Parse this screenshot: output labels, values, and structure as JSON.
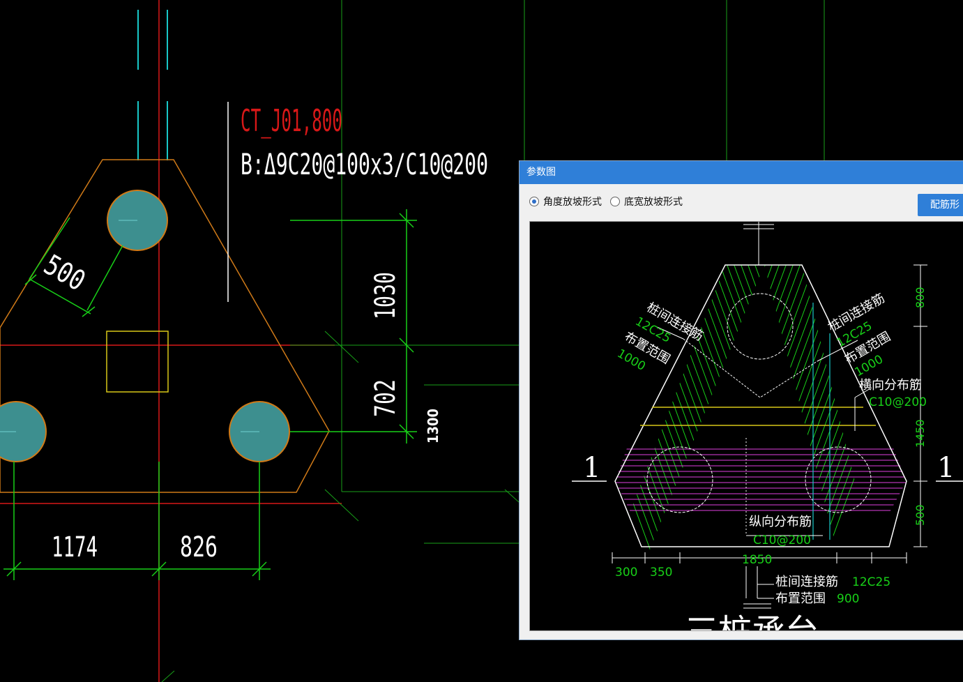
{
  "cad": {
    "label_ct": "CT_J01,800",
    "label_b": "B:Δ9C20@100x3/C10@200",
    "dim_500": "500",
    "dim_1030": "1030",
    "dim_702": "702",
    "dim_1300": "1300",
    "dim_1174": "1174",
    "dim_826": "826"
  },
  "dialog": {
    "title": "参数图",
    "option_angle": "角度放坡形式",
    "option_width": "底宽放坡形式",
    "button_label": "配筋形",
    "preview": {
      "left_title_1": "桩间连接筋",
      "left_value_1": "12C25",
      "left_title_2": "布置范围",
      "left_value_2": "1000",
      "right_title_1": "桩间连接筋",
      "right_value_1": "12C25",
      "right_title_2": "布置范围",
      "right_value_2": "1000",
      "transverse_title": "横向分布筋",
      "transverse_value": "C10@200",
      "longitudinal_title": "纵向分布筋",
      "longitudinal_value": "C10@200",
      "bottom_title_1": "桩间连接筋",
      "bottom_value_1": "12C25",
      "bottom_title_2": "布置范围",
      "bottom_value_2": "900",
      "dim_800": "800",
      "dim_1450": "1450",
      "dim_500": "500",
      "dim_1850": "1850",
      "dim_300": "300",
      "dim_350": "350",
      "section_left": "1",
      "section_right": "1",
      "caption": "三桩承台"
    }
  },
  "colors": {
    "green": "#18d018",
    "red": "#d81818",
    "cyan": "#18c8c8",
    "orange": "#d07a18",
    "yellow": "#d8c818",
    "magenta": "#e040e0",
    "pile_fill": "#3d8f8f"
  }
}
